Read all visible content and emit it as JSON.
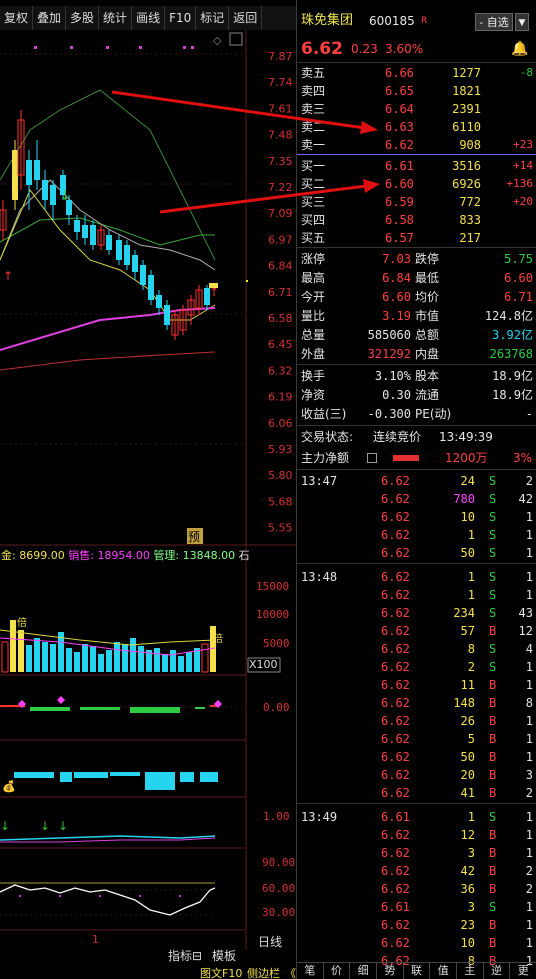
{
  "toolbar": {
    "items": [
      "复权",
      "叠加",
      "多股",
      "统计",
      "画线",
      "F10",
      "标记",
      "返回"
    ]
  },
  "price_axis": [
    "7.87",
    "7.74",
    "7.61",
    "7.48",
    "7.35",
    "7.22",
    "7.09",
    "6.97",
    "6.84",
    "6.71",
    "6.58",
    "6.45",
    "6.32",
    "6.19",
    "6.06",
    "5.93",
    "5.80",
    "5.68",
    "5.55"
  ],
  "price_box": "6.62",
  "fund_line": {
    "prefix": "金:",
    "fund": "8699.00",
    "sale_label": "销售:",
    "sale": "18954.00",
    "mgmt_label": "管理:",
    "mgmt": "13848.00",
    "tail": "石"
  },
  "pre_mark": "预",
  "vol_axis": [
    "15000",
    "10000",
    "5000",
    "X100"
  ],
  "bei_mark": "倍",
  "macd_axis": "0.00",
  "ind_axis": "1.00",
  "rsi_axis": [
    "90.00",
    "60.00",
    "30.00"
  ],
  "x_tick": "1",
  "bottom": {
    "tab1": "指标⊟",
    "tab2": "模板",
    "tab3": "日线",
    "tab4": "图文F10",
    "tab5": "侧边栏",
    "tab6": "《"
  },
  "stock": {
    "name": "珠免集团",
    "code": "600185",
    "tag": "R",
    "btn": "- 自选",
    "price": "6.62",
    "chg": "0.23",
    "pct": "3.60%"
  },
  "asks": [
    {
      "label": "卖五",
      "price": "6.66",
      "vol": "1277",
      "chg": "-8"
    },
    {
      "label": "卖四",
      "price": "6.65",
      "vol": "1821",
      "chg": ""
    },
    {
      "label": "卖三",
      "price": "6.64",
      "vol": "2391",
      "chg": ""
    },
    {
      "label": "卖二",
      "price": "6.63",
      "vol": "6110",
      "chg": ""
    },
    {
      "label": "卖一",
      "price": "6.62",
      "vol": "908",
      "chg": "+23"
    }
  ],
  "bids": [
    {
      "label": "买一",
      "price": "6.61",
      "vol": "3516",
      "chg": "+14"
    },
    {
      "label": "买二",
      "price": "6.60",
      "vol": "6926",
      "chg": "+136"
    },
    {
      "label": "买三",
      "price": "6.59",
      "vol": "772",
      "chg": "+20"
    },
    {
      "label": "买四",
      "price": "6.58",
      "vol": "833",
      "chg": ""
    },
    {
      "label": "买五",
      "price": "6.57",
      "vol": "217",
      "chg": ""
    }
  ],
  "stats": [
    {
      "l1": "涨停",
      "v1": "7.03",
      "c1": "red",
      "l2": "跌停",
      "v2": "5.75",
      "c2": "grn"
    },
    {
      "l1": "最高",
      "v1": "6.84",
      "c1": "red",
      "l2": "最低",
      "v2": "6.60",
      "c2": "red"
    },
    {
      "l1": "今开",
      "v1": "6.60",
      "c1": "red",
      "l2": "均价",
      "v2": "6.71",
      "c2": "red"
    },
    {
      "l1": "量比",
      "v1": "3.19",
      "c1": "red",
      "l2": "市值",
      "v2": "124.8亿",
      "c2": "wht"
    },
    {
      "l1": "总量",
      "v1": "585060",
      "c1": "wht",
      "l2": "总额",
      "v2": "3.92亿",
      "c2": "cyn"
    },
    {
      "l1": "外盘",
      "v1": "321292",
      "c1": "red",
      "l2": "内盘",
      "v2": "263768",
      "c2": "grn"
    }
  ],
  "stats2": [
    {
      "l1": "换手",
      "v1": "3.10%",
      "l2": "股本",
      "v2": "18.9亿"
    },
    {
      "l1": "净资",
      "v1": "0.30",
      "l2": "流通",
      "v2": "18.9亿"
    },
    {
      "l1": "收益(三)",
      "v1": "-0.300",
      "l2": "PE(动)",
      "v2": "-"
    }
  ],
  "status": {
    "label": "交易状态:",
    "value": "连续竞价",
    "time": "13:49:39"
  },
  "main_flow": {
    "label": "主力净额",
    "value": "1200万",
    "pct": "3%"
  },
  "ticks": [
    {
      "t": "13:47",
      "p": "6.62",
      "pc": "red",
      "v": "24",
      "vc": "yel",
      "s": "S",
      "sc": "grn",
      "n": "2"
    },
    {
      "t": "",
      "p": "6.62",
      "pc": "red",
      "v": "780",
      "vc": "mag",
      "s": "S",
      "sc": "grn",
      "n": "42"
    },
    {
      "t": "",
      "p": "6.62",
      "pc": "red",
      "v": "10",
      "vc": "yel",
      "s": "S",
      "sc": "grn",
      "n": "1"
    },
    {
      "t": "",
      "p": "6.62",
      "pc": "red",
      "v": "1",
      "vc": "yel",
      "s": "S",
      "sc": "grn",
      "n": "1"
    },
    {
      "t": "",
      "p": "6.62",
      "pc": "red",
      "v": "50",
      "vc": "yel",
      "s": "S",
      "sc": "grn",
      "n": "1"
    },
    {
      "t": "13:48",
      "p": "6.62",
      "pc": "red",
      "v": "1",
      "vc": "yel",
      "s": "S",
      "sc": "grn",
      "n": "1"
    },
    {
      "t": "",
      "p": "6.62",
      "pc": "red",
      "v": "1",
      "vc": "yel",
      "s": "S",
      "sc": "grn",
      "n": "1"
    },
    {
      "t": "",
      "p": "6.62",
      "pc": "red",
      "v": "234",
      "vc": "yel",
      "s": "S",
      "sc": "grn",
      "n": "43"
    },
    {
      "t": "",
      "p": "6.62",
      "pc": "red",
      "v": "57",
      "vc": "yel",
      "s": "B",
      "sc": "red",
      "n": "12"
    },
    {
      "t": "",
      "p": "6.62",
      "pc": "red",
      "v": "8",
      "vc": "yel",
      "s": "S",
      "sc": "grn",
      "n": "4"
    },
    {
      "t": "",
      "p": "6.62",
      "pc": "red",
      "v": "2",
      "vc": "yel",
      "s": "S",
      "sc": "grn",
      "n": "1"
    },
    {
      "t": "",
      "p": "6.62",
      "pc": "red",
      "v": "11",
      "vc": "yel",
      "s": "B",
      "sc": "red",
      "n": "1"
    },
    {
      "t": "",
      "p": "6.62",
      "pc": "red",
      "v": "148",
      "vc": "yel",
      "s": "B",
      "sc": "red",
      "n": "8"
    },
    {
      "t": "",
      "p": "6.62",
      "pc": "red",
      "v": "26",
      "vc": "yel",
      "s": "B",
      "sc": "red",
      "n": "1"
    },
    {
      "t": "",
      "p": "6.62",
      "pc": "red",
      "v": "5",
      "vc": "yel",
      "s": "B",
      "sc": "red",
      "n": "1"
    },
    {
      "t": "",
      "p": "6.62",
      "pc": "red",
      "v": "50",
      "vc": "yel",
      "s": "B",
      "sc": "red",
      "n": "1"
    },
    {
      "t": "",
      "p": "6.62",
      "pc": "red",
      "v": "20",
      "vc": "yel",
      "s": "B",
      "sc": "red",
      "n": "3"
    },
    {
      "t": "",
      "p": "6.62",
      "pc": "red",
      "v": "41",
      "vc": "yel",
      "s": "B",
      "sc": "red",
      "n": "2"
    },
    {
      "t": "13:49",
      "p": "6.61",
      "pc": "red",
      "v": "1",
      "vc": "yel",
      "s": "S",
      "sc": "grn",
      "n": "1"
    },
    {
      "t": "",
      "p": "6.62",
      "pc": "red",
      "v": "12",
      "vc": "yel",
      "s": "B",
      "sc": "red",
      "n": "1"
    },
    {
      "t": "",
      "p": "6.62",
      "pc": "red",
      "v": "3",
      "vc": "yel",
      "s": "B",
      "sc": "red",
      "n": "1"
    },
    {
      "t": "",
      "p": "6.62",
      "pc": "red",
      "v": "42",
      "vc": "yel",
      "s": "B",
      "sc": "red",
      "n": "2"
    },
    {
      "t": "",
      "p": "6.62",
      "pc": "red",
      "v": "36",
      "vc": "yel",
      "s": "B",
      "sc": "red",
      "n": "2"
    },
    {
      "t": "",
      "p": "6.61",
      "pc": "red",
      "v": "3",
      "vc": "yel",
      "s": "S",
      "sc": "grn",
      "n": "1"
    },
    {
      "t": "",
      "p": "6.62",
      "pc": "red",
      "v": "23",
      "vc": "yel",
      "s": "B",
      "sc": "red",
      "n": "1"
    },
    {
      "t": "",
      "p": "6.62",
      "pc": "red",
      "v": "10",
      "vc": "yel",
      "s": "B",
      "sc": "red",
      "n": "1"
    },
    {
      "t": "",
      "p": "6.62",
      "pc": "red",
      "v": "8",
      "vc": "yel",
      "s": "B",
      "sc": "red",
      "n": "1"
    }
  ],
  "side_tabs": [
    "笔",
    "价",
    "细",
    "势",
    "联",
    "值",
    "主",
    "逆",
    "更"
  ],
  "colors": {
    "up": "#ff4040",
    "down": "#2ecc40",
    "volume": "#26d4f0",
    "accent": "#f4e04d"
  }
}
